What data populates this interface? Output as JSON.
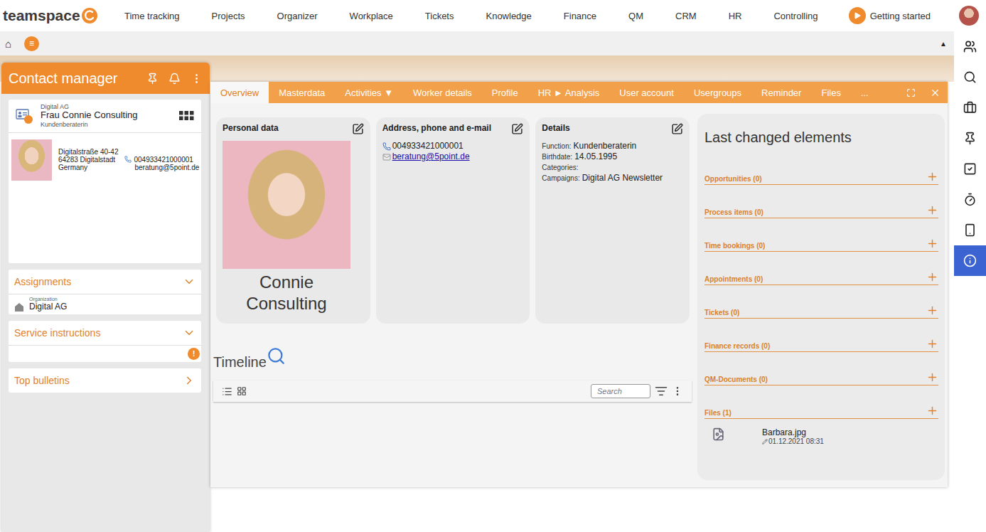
{
  "topnav": {
    "logo": "teamspace",
    "items": [
      {
        "label": "Time tracking",
        "selected": false
      },
      {
        "label": "Projects",
        "selected": false
      },
      {
        "label": "Organizer",
        "selected": false
      },
      {
        "label": "Workplace",
        "selected": false
      },
      {
        "label": "Tickets",
        "selected": false
      },
      {
        "label": "Knowledge",
        "selected": false
      },
      {
        "label": "Finance",
        "selected": false
      },
      {
        "label": "QM",
        "selected": false
      },
      {
        "label": "CRM",
        "selected": false
      },
      {
        "label": "HR",
        "selected": false
      },
      {
        "label": "Controlling",
        "selected": false
      }
    ],
    "getting_started": "Getting started"
  },
  "subbar": {
    "home": "⌂",
    "menu": "≡",
    "collapse": "▲"
  },
  "rail": [
    {
      "selected": false
    },
    {
      "selected": false
    },
    {
      "selected": false
    },
    {
      "selected": false
    },
    {
      "selected": false
    },
    {
      "selected": false
    },
    {
      "selected": false
    },
    {
      "selected": true
    }
  ],
  "contact_manager": {
    "title": "Contact manager",
    "contact": {
      "company": "Digital AG",
      "name": "Frau Connie Consulting",
      "function": "Kundenberaterin",
      "address": [
        "Digitalstraße 40-42",
        "64283 Digitalstadt",
        "Germany"
      ],
      "phone": "004933421000001",
      "email": "beratung@5point.de"
    },
    "sections": [
      {
        "title": "Assignments",
        "expanded": true,
        "kind": "organization",
        "label": "Organization",
        "value": "Digital AG"
      },
      {
        "title": "Service instructions",
        "expanded": true,
        "kind": "badge",
        "badge": "!"
      },
      {
        "title": "Top bulletins",
        "expanded": false,
        "kind": "empty"
      }
    ]
  },
  "window": {
    "tabs": [
      {
        "label": "Overview",
        "selected": true
      },
      {
        "label": "Masterdata",
        "selected": false
      },
      {
        "label": "Activities ▼",
        "selected": false
      },
      {
        "label": "Worker details",
        "selected": false
      },
      {
        "label": "Profile",
        "selected": false
      },
      {
        "label": "HR ► Analysis",
        "selected": false
      },
      {
        "label": "User account",
        "selected": false
      },
      {
        "label": "Usergroups",
        "selected": false
      },
      {
        "label": "Reminder",
        "selected": false
      },
      {
        "label": "Files",
        "selected": false
      },
      {
        "label": "...",
        "selected": false
      }
    ],
    "personal_data": {
      "title": "Personal data",
      "name": "Connie Consulting"
    },
    "address": {
      "title": "Address, phone and e-mail",
      "phone": "004933421000001",
      "email": "beratung@5point.de"
    },
    "details": {
      "title": "Details",
      "rows": [
        {
          "label": "Function:",
          "value": "Kundenberaterin"
        },
        {
          "label": "Birthdate:",
          "value": "14.05.1995"
        },
        {
          "label": "Categories:",
          "value": ""
        },
        {
          "label": "Campaigns:",
          "value": "Digital AG Newsletter"
        }
      ]
    },
    "timeline": {
      "title": "Timeline",
      "search_placeholder": "Search"
    },
    "last_changed": {
      "title": "Last changed elements",
      "sections": [
        {
          "label": "Opportunities (0)",
          "items": []
        },
        {
          "label": "Process items (0)",
          "items": []
        },
        {
          "label": "Time bookings (0)",
          "items": []
        },
        {
          "label": "Appointments (0)",
          "items": []
        },
        {
          "label": "Tickets (0)",
          "items": []
        },
        {
          "label": "Finance records (0)",
          "items": []
        },
        {
          "label": "QM-Documents (0)",
          "items": []
        },
        {
          "label": "Files (1)",
          "items": [
            {
              "name": "Barbara.jpg",
              "date": "01.12.2021 08:31"
            }
          ]
        }
      ]
    }
  }
}
